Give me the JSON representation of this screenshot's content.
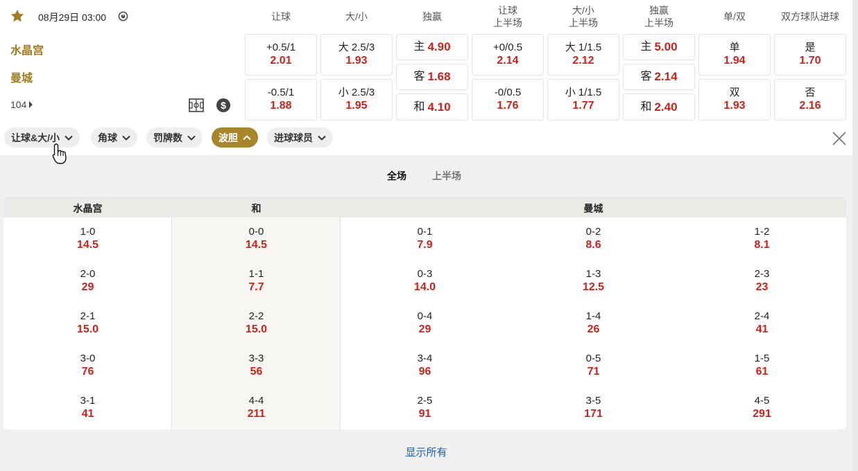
{
  "match": {
    "datetime": "08月29日 03:00",
    "home": "水晶宫",
    "away": "曼城",
    "more_count": "104"
  },
  "headers": [
    {
      "line1": "让球",
      "line2": ""
    },
    {
      "line1": "大/小",
      "line2": ""
    },
    {
      "line1": "独赢",
      "line2": ""
    },
    {
      "line1": "让球",
      "line2": "上半场"
    },
    {
      "line1": "大/小",
      "line2": "上半场"
    },
    {
      "line1": "独赢",
      "line2": "上半场"
    },
    {
      "line1": "单/双",
      "line2": ""
    },
    {
      "line1": "双方球队进球",
      "line2": ""
    }
  ],
  "odds": {
    "handicap": [
      {
        "label": "+0.5/1",
        "odd": "2.01"
      },
      {
        "label": "-0.5/1",
        "odd": "1.88"
      }
    ],
    "over_under": [
      {
        "label": "大 2.5/3",
        "odd": "1.93"
      },
      {
        "label": "小 2.5/3",
        "odd": "1.95"
      }
    ],
    "moneyline": [
      {
        "label": "主",
        "odd": "4.90"
      },
      {
        "label": "客",
        "odd": "1.68"
      },
      {
        "label": "和",
        "odd": "4.10"
      }
    ],
    "handicap_1h": [
      {
        "label": "+0/0.5",
        "odd": "2.14"
      },
      {
        "label": "-0/0.5",
        "odd": "1.76"
      }
    ],
    "over_under_1h": [
      {
        "label": "大 1/1.5",
        "odd": "2.12"
      },
      {
        "label": "小 1/1.5",
        "odd": "1.77"
      }
    ],
    "moneyline_1h": [
      {
        "label": "主",
        "odd": "5.00"
      },
      {
        "label": "客",
        "odd": "2.14"
      },
      {
        "label": "和",
        "odd": "2.40"
      }
    ],
    "odd_even": [
      {
        "label": "单",
        "odd": "1.94"
      },
      {
        "label": "双",
        "odd": "1.93"
      }
    ],
    "both_score": [
      {
        "label": "是",
        "odd": "1.70"
      },
      {
        "label": "否",
        "odd": "2.16"
      }
    ]
  },
  "filters": [
    {
      "label": "让球&大/小",
      "active": false
    },
    {
      "label": "角球",
      "active": false
    },
    {
      "label": "罚牌数",
      "active": false
    },
    {
      "label": "波胆",
      "active": true
    },
    {
      "label": "进球球员",
      "active": false
    }
  ],
  "period_tabs": [
    "全场",
    "上半场"
  ],
  "correct_score": {
    "headers": {
      "home": "水晶宫",
      "draw": "和",
      "away": "曼城"
    },
    "columns": [
      [
        {
          "score": "1-0",
          "odd": "14.5"
        },
        {
          "score": "2-0",
          "odd": "29"
        },
        {
          "score": "2-1",
          "odd": "15.0"
        },
        {
          "score": "3-0",
          "odd": "76"
        },
        {
          "score": "3-1",
          "odd": "41"
        }
      ],
      [
        {
          "score": "0-0",
          "odd": "14.5"
        },
        {
          "score": "1-1",
          "odd": "7.7"
        },
        {
          "score": "2-2",
          "odd": "15.0"
        },
        {
          "score": "3-3",
          "odd": "56"
        },
        {
          "score": "4-4",
          "odd": "211"
        }
      ],
      [
        {
          "score": "0-1",
          "odd": "7.9"
        },
        {
          "score": "0-3",
          "odd": "14.0"
        },
        {
          "score": "0-4",
          "odd": "29"
        },
        {
          "score": "3-4",
          "odd": "96"
        },
        {
          "score": "2-5",
          "odd": "91"
        }
      ],
      [
        {
          "score": "0-2",
          "odd": "8.6"
        },
        {
          "score": "1-3",
          "odd": "12.5"
        },
        {
          "score": "1-4",
          "odd": "26"
        },
        {
          "score": "0-5",
          "odd": "71"
        },
        {
          "score": "3-5",
          "odd": "171"
        }
      ],
      [
        {
          "score": "1-2",
          "odd": "8.1"
        },
        {
          "score": "2-3",
          "odd": "23"
        },
        {
          "score": "2-4",
          "odd": "41"
        },
        {
          "score": "1-5",
          "odd": "61"
        },
        {
          "score": "4-5",
          "odd": "291"
        }
      ]
    ]
  },
  "show_all": "显示所有",
  "colors": {
    "gold": "#a88528",
    "odd_red": "#c8241c",
    "link_blue": "#1a5fb4"
  },
  "icons": [
    "star-icon",
    "clock-icon",
    "chevron-right-icon",
    "pitch-icon",
    "dollar-icon",
    "chevron-down-icon",
    "chevron-up-icon",
    "close-icon",
    "hand-cursor-icon"
  ]
}
